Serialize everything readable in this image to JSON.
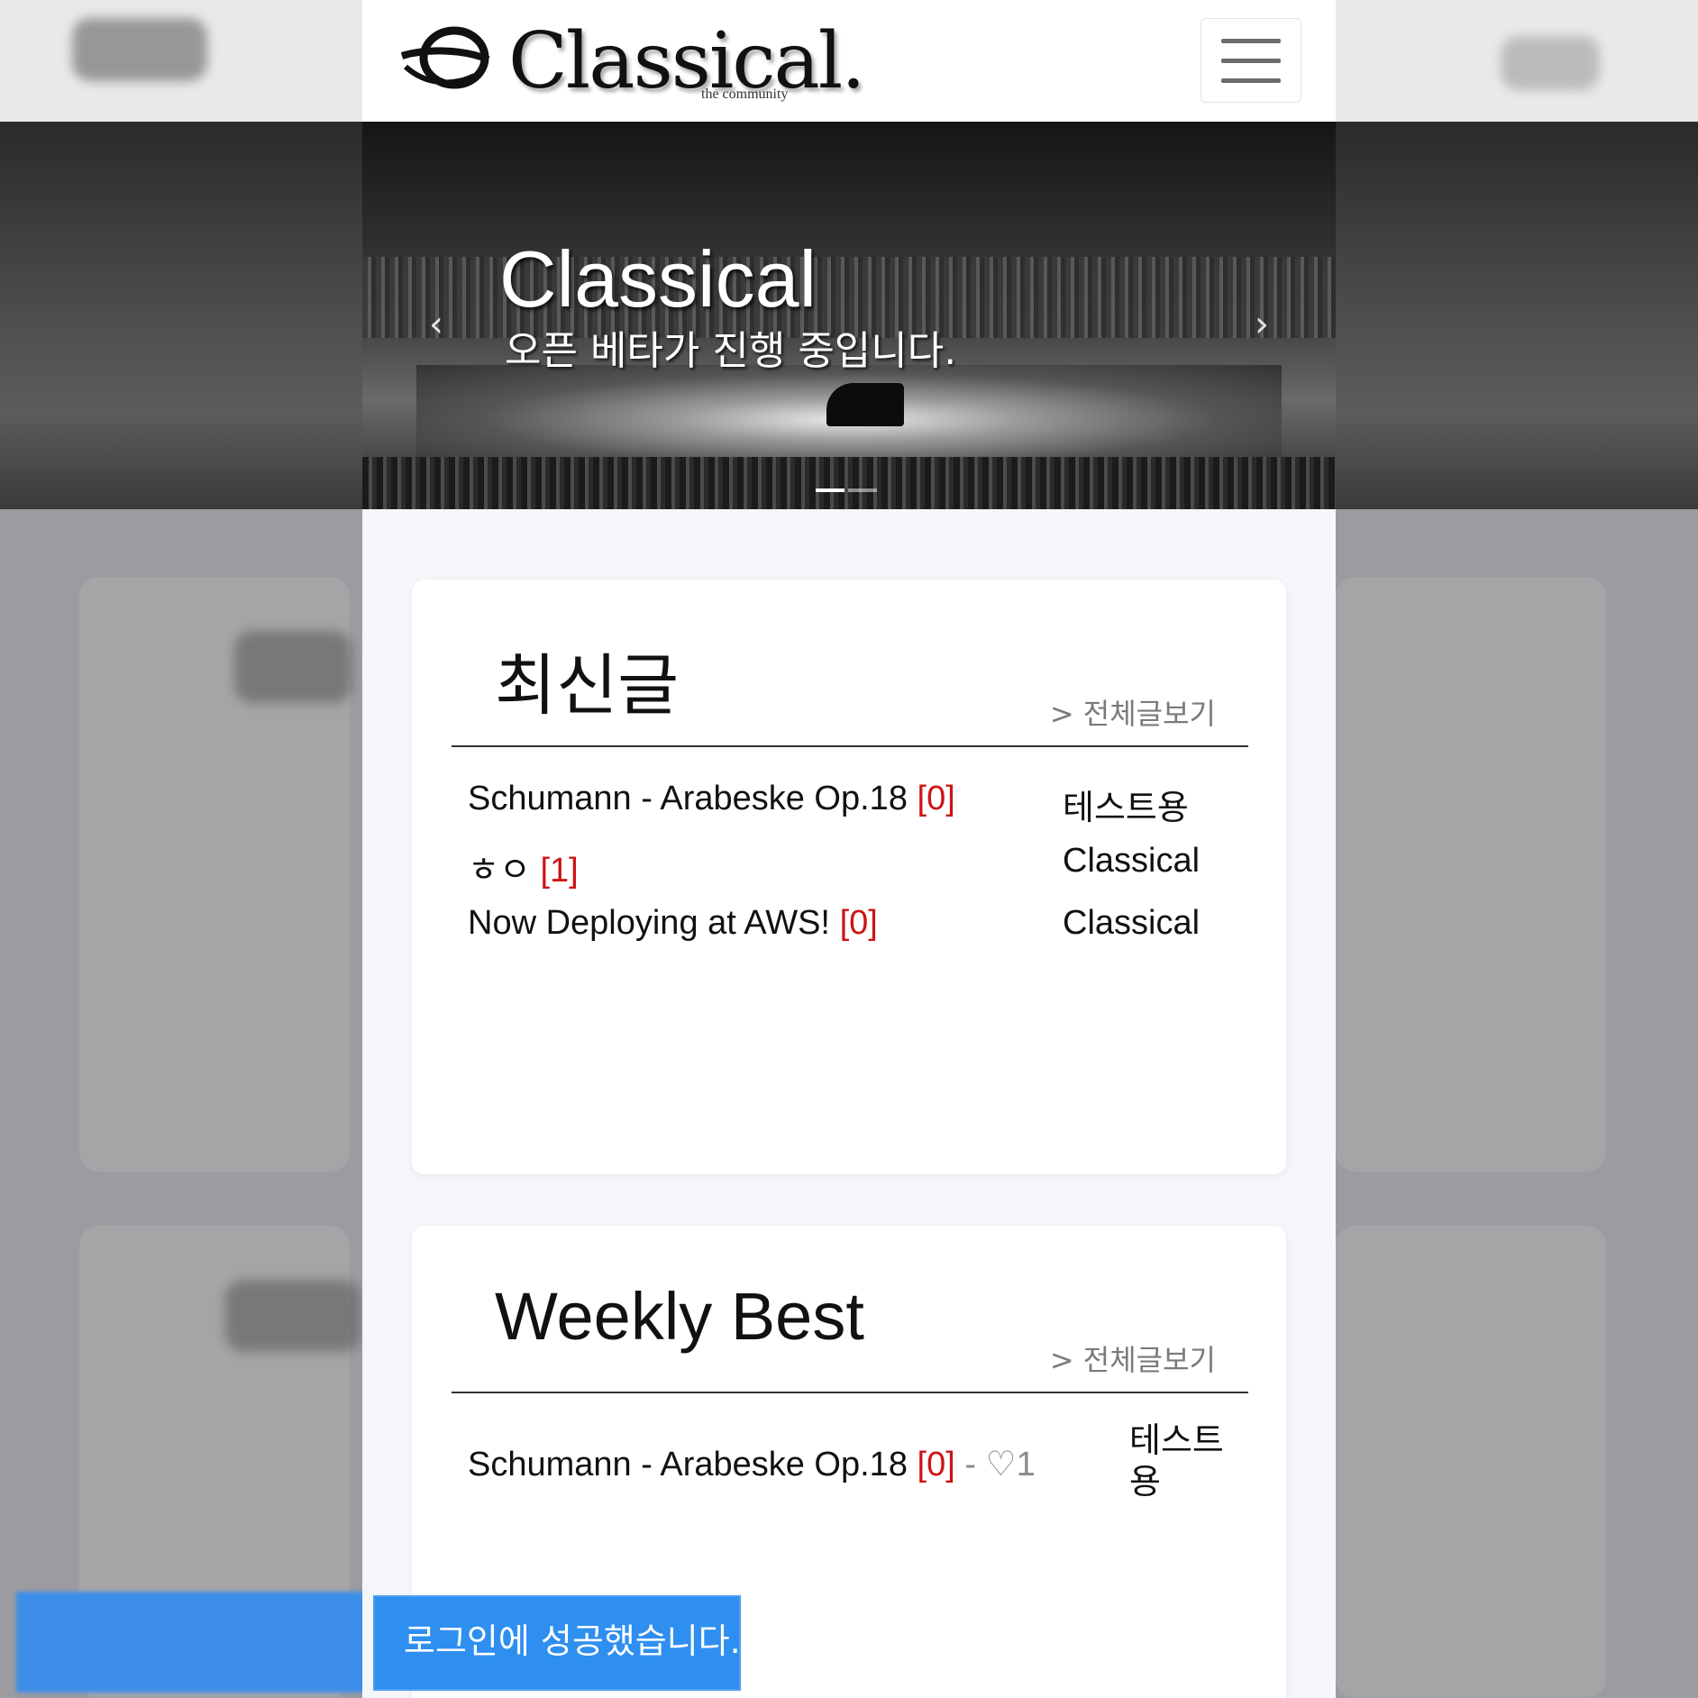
{
  "brand": {
    "name": "Classical.",
    "tagline": "the community"
  },
  "hero": {
    "title": "Classical",
    "subtitle": "오픈 베타가 진행 중입니다."
  },
  "latest": {
    "title": "최신글",
    "more": "> 전체글보기",
    "posts": [
      {
        "title": "Schumann - Arabeske Op.18",
        "comments": "[0]",
        "author": "테스트용"
      },
      {
        "title": "ㅎㅇ",
        "comments": "[1]",
        "author": "Classical"
      },
      {
        "title": "Now Deploying at AWS!",
        "comments": "[0]",
        "author": "Classical"
      }
    ]
  },
  "weekly": {
    "title": "Weekly Best",
    "more": "> 전체글보기",
    "posts": [
      {
        "title": "Schumann - Arabeske Op.18",
        "comments": "[0]",
        "likes": "- ♡1",
        "author": "테스트용"
      }
    ]
  },
  "toast": {
    "message": "로그인에 성공했습니다."
  },
  "colors": {
    "comment_count": "#cc1414",
    "toast_bg": "#2e8ff0"
  }
}
